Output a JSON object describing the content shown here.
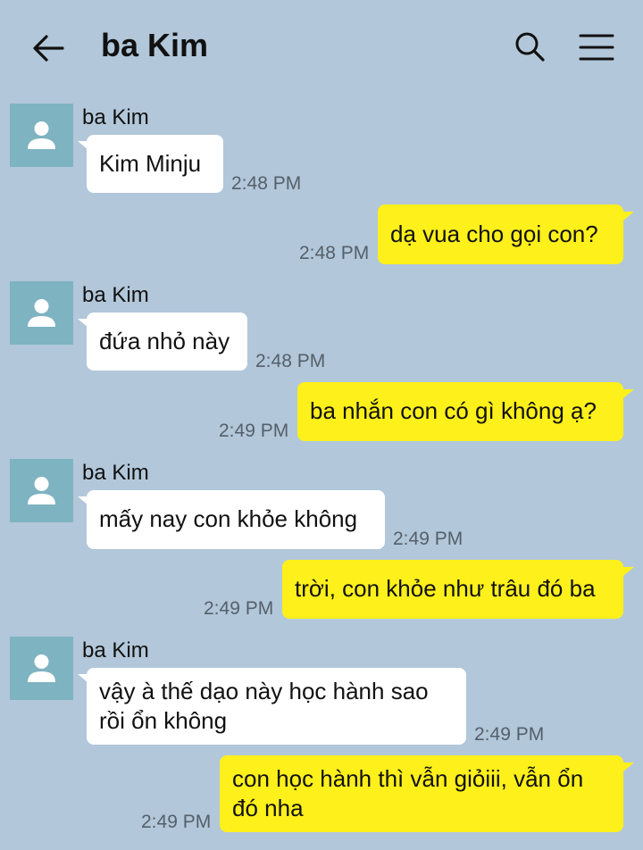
{
  "header": {
    "title": "ba Kim",
    "back_icon": "arrow-left-icon",
    "search_icon": "search-icon",
    "menu_icon": "menu-icon"
  },
  "colors": {
    "background": "#b2c7da",
    "incoming_bubble": "#ffffff",
    "outgoing_bubble": "#fef01b",
    "avatar": "#7eb3c1"
  },
  "messages": [
    {
      "direction": "in",
      "sender": "ba Kim",
      "lines": [
        "Kim Minju"
      ],
      "time": "2:48 PM"
    },
    {
      "direction": "out",
      "lines": [
        "dạ vua cho gọi con?"
      ],
      "time": "2:48 PM"
    },
    {
      "direction": "in",
      "sender": "ba Kim",
      "lines": [
        "đứa nhỏ này"
      ],
      "time": "2:48 PM"
    },
    {
      "direction": "out",
      "lines": [
        "ba nhắn con có gì không ạ?"
      ],
      "time": "2:49 PM"
    },
    {
      "direction": "in",
      "sender": "ba Kim",
      "lines": [
        "mấy nay con khỏe không"
      ],
      "time": "2:49 PM"
    },
    {
      "direction": "out",
      "lines": [
        "trời, con khỏe như trâu đó ba"
      ],
      "time": "2:49 PM"
    },
    {
      "direction": "in",
      "sender": "ba Kim",
      "lines": [
        "vậy à thế dạo này học hành sao",
        "rồi ổn không"
      ],
      "time": "2:49 PM"
    },
    {
      "direction": "out",
      "lines": [
        "con học hành thì vẫn giỏiii, vẫn ổn",
        "đó nha"
      ],
      "time": "2:49 PM"
    }
  ]
}
